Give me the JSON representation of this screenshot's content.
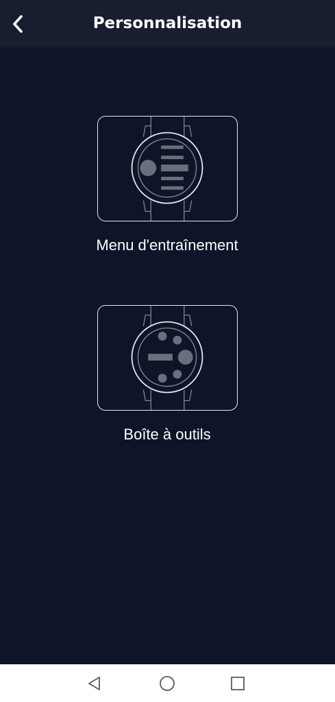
{
  "header": {
    "title": "Personnalisation",
    "back_icon": "chevron-left-icon"
  },
  "options": [
    {
      "label": "Menu d'entraînement",
      "icon": "watch-training-menu-icon"
    },
    {
      "label": "Boîte à outils",
      "icon": "watch-toolbox-icon"
    }
  ],
  "system_nav": {
    "back_icon": "triangle-back-icon",
    "home_icon": "circle-home-icon",
    "recents_icon": "square-recents-icon"
  },
  "colors": {
    "background": "#0f1528",
    "app_bar": "#181e2f",
    "card_border": "#e6e8ee",
    "watch_line": "#7f8597",
    "watch_fill": "#6a6f7e",
    "nav_bar": "#ffffff"
  }
}
